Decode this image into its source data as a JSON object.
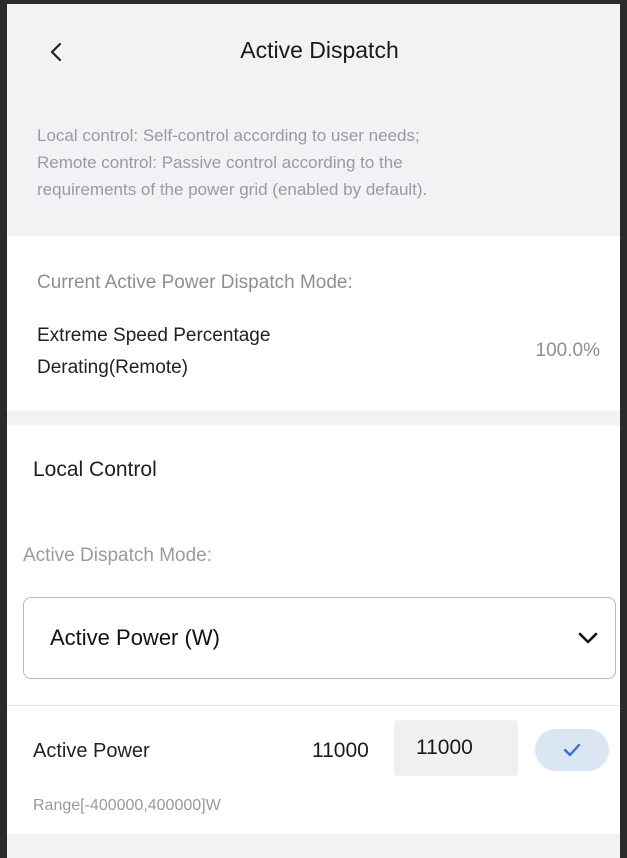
{
  "header": {
    "back_icon": "chevron-left-icon",
    "title": "Active Dispatch"
  },
  "notice": {
    "lines": [
      "Local control: Self-control according to user needs;",
      "Remote control: Passive control according to the",
      "requirements of the power grid (enabled by default)."
    ]
  },
  "current_mode": {
    "label": "Current Active Power Dispatch Mode:",
    "mode_line1": "Extreme Speed Percentage",
    "mode_line2": "Derating(Remote)",
    "value": "100.0%"
  },
  "local_control": {
    "title": "Local Control",
    "mode_label": "Active Dispatch Mode:",
    "selected_mode": "Active Power (W)",
    "dropdown_icon": "chevron-down-icon",
    "power": {
      "label": "Active Power",
      "current_value": "11000",
      "input_value": "11000",
      "confirm_icon": "check-icon",
      "accent": "#3a6fd1"
    },
    "range": "Range[-400000,400000]W"
  }
}
